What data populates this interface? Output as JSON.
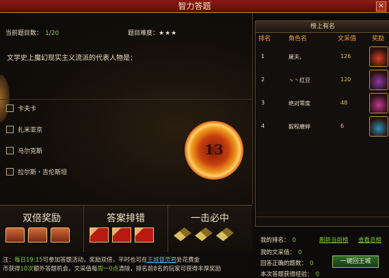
{
  "window": {
    "title": "智力答题",
    "close_label": "×"
  },
  "quiz": {
    "current_label": "当前题目数：",
    "current_value": "1/20",
    "difficulty_label": "题目难度：",
    "difficulty_stars": "★★★",
    "question": "文学史上魔幻现实主义流派的代表人物是：",
    "options": [
      "卡夫卡",
      "扎米亚京",
      "马尔克斯",
      "拉尔斯・吉伦斯坦"
    ],
    "timer": "13"
  },
  "bonus": {
    "cards": [
      {
        "label": "双倍奖励"
      },
      {
        "label": "答案排错"
      },
      {
        "label": "一击必中"
      }
    ]
  },
  "notice": {
    "p1": "注：",
    "p2": "每日19:15",
    "p3": "可参加答题活动，奖励双倍，平时也可在",
    "p4": "王城督灵君",
    "p5": "处花费金",
    "p6": "币获得",
    "p7": "10次",
    "p8": "额外答题机会，文采值每",
    "p9": "周一0点",
    "p10": "清除，排名前8名的玩家可获得丰厚奖励"
  },
  "rank": {
    "title": "榜上有名",
    "columns": [
      "排名",
      "角色名",
      "文采值",
      "奖励"
    ],
    "rows": [
      {
        "rank": "1",
        "name": "屠夫、",
        "score": "126",
        "bag_color": "#d04020"
      },
      {
        "rank": "2",
        "name": "ヽ丶红豆",
        "score": "120",
        "bag_color": "#8a3aa8"
      },
      {
        "rank": "3",
        "name": "绝对零度",
        "score": "48",
        "bag_color": "#c03a90"
      },
      {
        "rank": "4",
        "name": "毅程磨婷",
        "score": "6",
        "bag_color": "#2a90b0"
      }
    ]
  },
  "mine": {
    "rank_label": "我的排名：",
    "rank_value": "0",
    "refresh_link": "刷新当前榜",
    "view_link": "查看总榜",
    "score_label": "我的文采值：",
    "score_value": "0",
    "correct_label": "回答正确的题数：",
    "correct_value": "0",
    "exp_label": "本次答题获得经验：",
    "exp_value": "0",
    "back_button": "一键回王城"
  }
}
